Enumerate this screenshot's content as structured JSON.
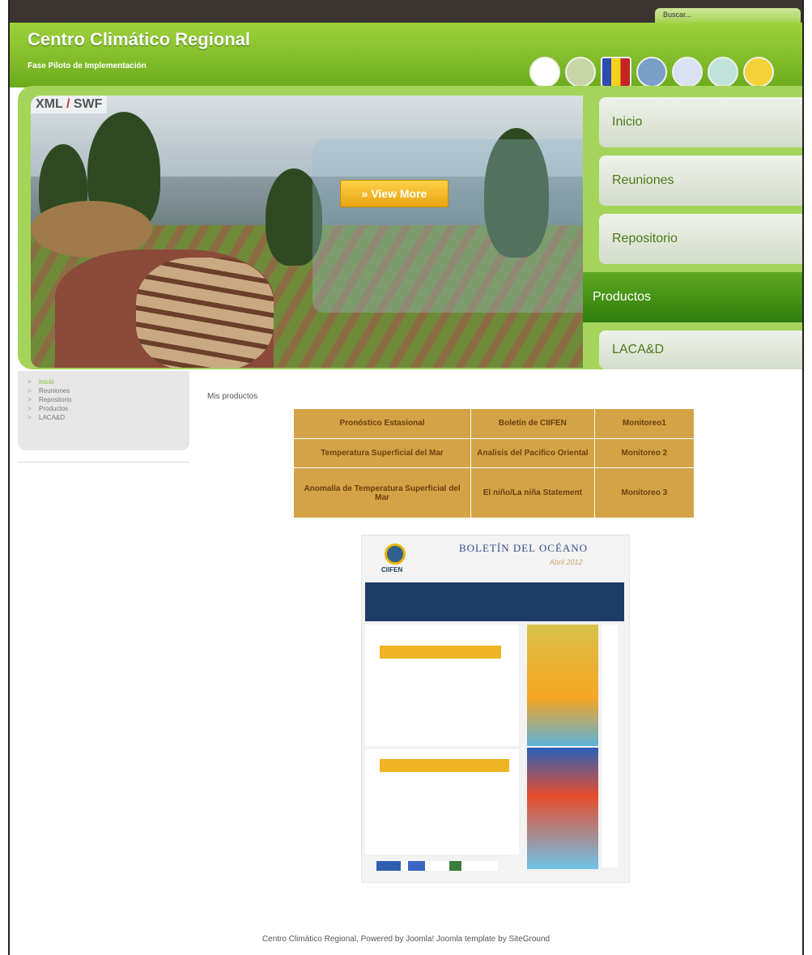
{
  "search": {
    "placeholder": "Buscar..."
  },
  "header": {
    "title": "Centro Climático Regional",
    "subtitle": "Fase Piloto de Implementación"
  },
  "slideshow": {
    "xml_label": "XML",
    "slash": "/",
    "swf_label": "SWF",
    "view_more": "» View More"
  },
  "main_menu": [
    {
      "label": "Inicio"
    },
    {
      "label": "Reuniones"
    },
    {
      "label": "Repositorio"
    },
    {
      "label": "Productos"
    },
    {
      "label": "LACA&D"
    }
  ],
  "left_menu": [
    {
      "label": "Inicio"
    },
    {
      "label": "Reuniones"
    },
    {
      "label": "Repositorio"
    },
    {
      "label": "Productos"
    },
    {
      "label": "LACA&D"
    }
  ],
  "content": {
    "heading": "Mis productos",
    "products": [
      [
        "Pronóstico Estasional",
        "Boletín de CIIFEN",
        "Monitoreo1"
      ],
      [
        "Temperatura Superficial del Mar",
        "Analisis del Pacifico Oriental",
        "Monitoreo 2"
      ],
      [
        "Anomalía de Temperatura Superficial del Mar",
        "El niño/La niña Statement",
        "Monitoreo 3"
      ]
    ],
    "bulletin": {
      "title": "BOLETÍN DEL OCÉANO",
      "org": "CIIFEN",
      "date": "Abril 2012"
    }
  },
  "footer": "Centro Climático Regional, Powered by Joomla! Joomla template by SiteGround",
  "colors": {
    "brand_green": "#6cab1d",
    "active_menu": "#2f7d0f",
    "product_cell": "#d4a345",
    "button_gold": "#f0b323"
  }
}
